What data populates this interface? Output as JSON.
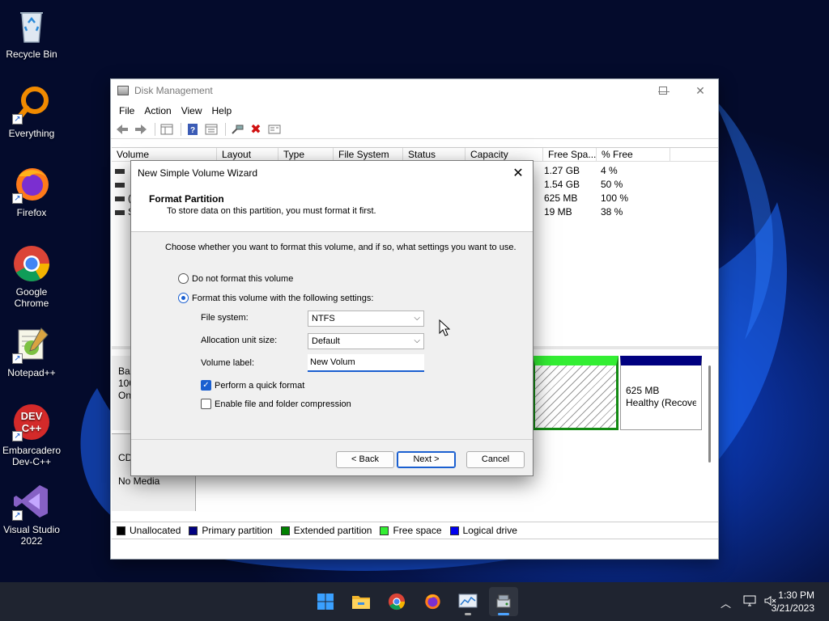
{
  "desktop": {
    "icons": [
      {
        "id": "recycle-bin",
        "label": "Recycle Bin"
      },
      {
        "id": "everything",
        "label": "Everything"
      },
      {
        "id": "firefox",
        "label": "Firefox"
      },
      {
        "id": "google-chrome",
        "label": "Google Chrome"
      },
      {
        "id": "notepadpp",
        "label": "Notepad++"
      },
      {
        "id": "devcpp",
        "label": "Embarcadero Dev-C++",
        "glyph_text": "DEV\nC++"
      },
      {
        "id": "visual-studio",
        "label": "Visual Studio 2022"
      }
    ]
  },
  "disk_management": {
    "title": "Disk Management",
    "menu": [
      "File",
      "Action",
      "View",
      "Help"
    ],
    "columns": [
      "Volume",
      "Layout",
      "Type",
      "File System",
      "Status",
      "Capacity",
      "Free Spa...",
      "% Free"
    ],
    "rows": [
      {
        "volume_fragment": "",
        "free_space": "1.27 GB",
        "percent_free": "4 %"
      },
      {
        "volume_fragment": "",
        "free_space": "1.54 GB",
        "percent_free": "50 %"
      },
      {
        "volume_fragment": "(",
        "free_space": "625 MB",
        "percent_free": "100 %"
      },
      {
        "volume_fragment": "S",
        "free_space": "19 MB",
        "percent_free": "38 %"
      }
    ],
    "disk0": {
      "label_lines": [
        "Bas",
        "100",
        "On"
      ]
    },
    "recovery_partition": {
      "size": "625 MB",
      "status": "Healthy (Recove"
    },
    "cdrom": {
      "label": "CD",
      "media": "No Media"
    },
    "legend": [
      {
        "label": "Unallocated",
        "color": "#000000"
      },
      {
        "label": "Primary partition",
        "color": "#000080"
      },
      {
        "label": "Extended partition",
        "color": "#008000"
      },
      {
        "label": "Free space",
        "color": "#33ee33"
      },
      {
        "label": "Logical drive",
        "color": "#0000ee"
      }
    ]
  },
  "wizard": {
    "title": "New Simple Volume Wizard",
    "header_title": "Format Partition",
    "header_subtitle": "To store data on this partition, you must format it first.",
    "intro": "Choose whether you want to format this volume, and if so, what settings you want to use.",
    "option_no_format": "Do not format this volume",
    "option_format": "Format this volume with the following settings:",
    "selected_option": "format",
    "file_system_label": "File system:",
    "file_system_value": "NTFS",
    "alloc_label": "Allocation unit size:",
    "alloc_value": "Default",
    "volume_label_label": "Volume label:",
    "volume_label_value": "New Volum",
    "quick_format_label": "Perform a quick format",
    "quick_format_checked": true,
    "compression_label": "Enable file and folder compression",
    "compression_checked": false,
    "back_button": "< Back",
    "next_button": "Next >",
    "cancel_button": "Cancel"
  },
  "taskbar": {
    "time": "1:30 PM",
    "date": "3/21/2023"
  },
  "colors": {
    "accent": "#1a5fd0",
    "taskbar": "#1f2430"
  }
}
